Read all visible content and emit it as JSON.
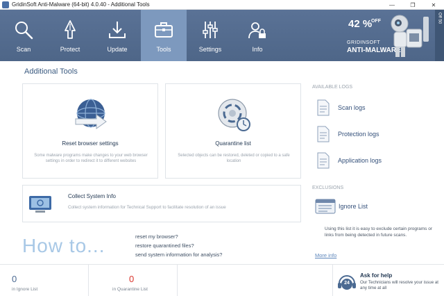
{
  "window": {
    "title": "GridinSoft Anti-Malware (64-bit) 4.0.40 - Additional Tools",
    "minimize": "—",
    "maximize": "❐",
    "close": "✕"
  },
  "nav": {
    "items": [
      {
        "label": "Scan",
        "icon": "magnifier-icon"
      },
      {
        "label": "Protect",
        "icon": "shield-icon"
      },
      {
        "label": "Update",
        "icon": "download-icon"
      },
      {
        "label": "Tools",
        "icon": "toolbox-icon"
      },
      {
        "label": "Settings",
        "icon": "sliders-icon"
      },
      {
        "label": "Info",
        "icon": "user-lock-icon"
      }
    ],
    "active": "Tools"
  },
  "promo": {
    "percent": "42 %",
    "off": "OFF",
    "brand_line1": "GRIDINSOFT",
    "brand_line2": "ANTI-MALWARE"
  },
  "sidebar_tab": "Off 50",
  "page_title": "Additional Tools",
  "tools": {
    "reset_browser": {
      "title": "Reset browser settings",
      "desc": "Some malware programs make changes to your web browser settings in order to redirect it to different websites"
    },
    "quarantine": {
      "title": "Quarantine list",
      "desc": "Selected objects can be restored, deleted or copied to a safe location"
    },
    "collect_info": {
      "title": "Collect System Info",
      "desc": "Collect system information for Technical Support to facilitate resolution of an issue"
    }
  },
  "howto": {
    "heading": "How to...",
    "links": [
      "reset my browser?",
      "restore quarantined files?",
      "send system information for analysis?"
    ]
  },
  "logs": {
    "section": "AVAILABLE LOGS",
    "items": [
      "Scan logs",
      "Protection logs",
      "Application logs"
    ]
  },
  "exclusions": {
    "section": "EXCLUSIONS",
    "item": "Ignore List",
    "desc": "Using this list it is easy to exclude certain programs or links from being detected in future scans.",
    "more": "More info"
  },
  "status": {
    "ignore_count": "0",
    "ignore_label": "in Ignore List",
    "quarantine_count": "0",
    "quarantine_label": "in Quarantine List"
  },
  "help": {
    "badge": "24",
    "title": "Ask for help",
    "desc": "Our Technicians will resolve your issue at any time at all"
  },
  "colors": {
    "nav_bg": "#4e6688",
    "nav_active": "#7d99be",
    "accent_text": "#34507a",
    "howto": "#a8c8e6",
    "quarantine_count": "#d9342b"
  }
}
